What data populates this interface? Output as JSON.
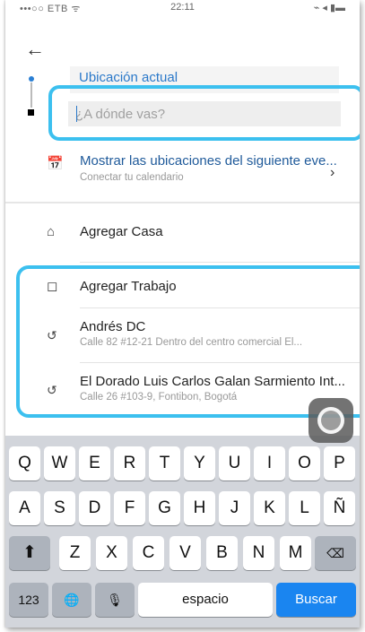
{
  "status_bar": {
    "carrier": "•••○○ ETB ᯤ",
    "time": "22:11",
    "battery": "⌁ ◂ ▮▬"
  },
  "nav": {
    "back_glyph": "←"
  },
  "route": {
    "origin_label": "Ubicación actual",
    "destination_placeholder": "¿A dónde vas?",
    "destination_value": ""
  },
  "calendar_item": {
    "icon": "calendar-icon",
    "icon_glyph": "📅",
    "title": "Mostrar las ubicaciones del siguiente eve...",
    "subtitle": "Conectar tu calendario",
    "chevron_glyph": "›"
  },
  "shortcuts": {
    "home": {
      "icon": "home-icon",
      "icon_glyph": "⌂",
      "label": "Agregar Casa"
    },
    "work": {
      "icon": "briefcase-icon",
      "icon_glyph": "◻",
      "label": "Agregar Trabajo"
    }
  },
  "recents": [
    {
      "icon": "history-icon",
      "icon_glyph": "↺",
      "title": "Andrés DC",
      "subtitle": "Calle 82 #12-21 Dentro del centro comercial El..."
    },
    {
      "icon": "history-icon",
      "icon_glyph": "↺",
      "title": "El Dorado Luis Carlos Galan Sarmiento Int...",
      "subtitle": "Calle 26 #103-9, Fontibon, Bogotá"
    }
  ],
  "keyboard": {
    "row1": [
      "Q",
      "W",
      "E",
      "R",
      "T",
      "Y",
      "U",
      "I",
      "O",
      "P"
    ],
    "row2": [
      "A",
      "S",
      "D",
      "F",
      "G",
      "H",
      "J",
      "K",
      "L",
      "Ñ"
    ],
    "row3": [
      "Z",
      "X",
      "C",
      "V",
      "B",
      "N",
      "M"
    ],
    "shift_glyph": "⬆",
    "delete_glyph": "⌫",
    "numbers_label": "123",
    "globe_glyph": "🌐",
    "mic_glyph": "🎙",
    "space_label": "espacio",
    "action_label": "Buscar"
  },
  "colors": {
    "accent": "#2a78c9",
    "highlight": "#3cc0ef",
    "key_blue": "#1a85f0"
  }
}
